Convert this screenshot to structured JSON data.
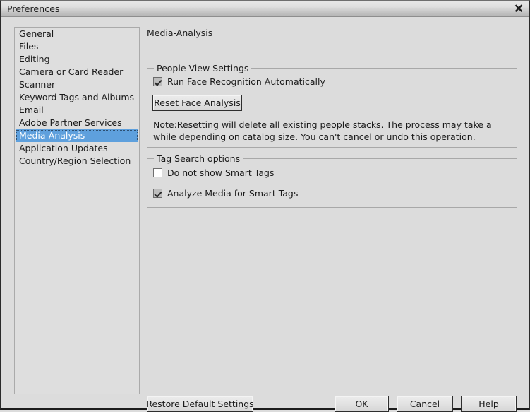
{
  "window": {
    "title": "Preferences",
    "close_icon": "close-x-icon"
  },
  "sidebar": {
    "items": [
      {
        "label": "General",
        "selected": false
      },
      {
        "label": "Files",
        "selected": false
      },
      {
        "label": "Editing",
        "selected": false
      },
      {
        "label": "Camera or Card Reader",
        "selected": false
      },
      {
        "label": "Scanner",
        "selected": false
      },
      {
        "label": "Keyword Tags and Albums",
        "selected": false
      },
      {
        "label": "Email",
        "selected": false
      },
      {
        "label": "Adobe Partner Services",
        "selected": false
      },
      {
        "label": "Media-Analysis",
        "selected": true
      },
      {
        "label": "Application Updates",
        "selected": false
      },
      {
        "label": "Country/Region Selection",
        "selected": false
      }
    ]
  },
  "main": {
    "pane_title": "Media-Analysis",
    "people_view": {
      "legend": "People View Settings",
      "run_face_recognition": {
        "label": "Run Face Recognition Automatically",
        "checked": true
      },
      "reset_button": "Reset Face Analysis",
      "note": "Note:Resetting will delete all existing people stacks. The process may take a while depending on catalog size. You can't cancel or undo this operation."
    },
    "tag_search": {
      "legend": "Tag Search options",
      "do_not_show_smart_tags": {
        "label": "Do not show Smart Tags",
        "checked": false
      },
      "analyze_media_for_smart_tags": {
        "label": "Analyze Media for Smart Tags",
        "checked": true
      }
    }
  },
  "footer": {
    "restore_defaults": "Restore Default Settings",
    "ok": "OK",
    "cancel": "Cancel",
    "help": "Help"
  },
  "colors": {
    "dialog_background": "#dcdcdc",
    "selection_blue": "#5ea0dd",
    "selection_text": "#ffffff",
    "text": "#1b1b1b",
    "group_border": "#a8a8a8",
    "button_border": "#2e2e2e"
  }
}
